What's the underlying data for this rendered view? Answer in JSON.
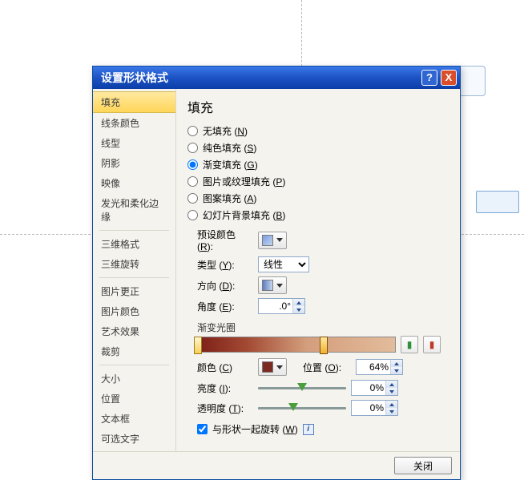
{
  "dialog": {
    "title": "设置形状格式",
    "close_button_label": "关闭"
  },
  "sidebar": {
    "items": [
      "填充",
      "线条颜色",
      "线型",
      "阴影",
      "映像",
      "发光和柔化边缘",
      "三维格式",
      "三维旋转",
      "图片更正",
      "图片颜色",
      "艺术效果",
      "裁剪",
      "大小",
      "位置",
      "文本框",
      "可选文字"
    ],
    "selected_index": 0,
    "separators_after": [
      5,
      7,
      11
    ]
  },
  "panel": {
    "heading": "填充",
    "fill_options": [
      {
        "label": "无填充",
        "key": "N"
      },
      {
        "label": "纯色填充",
        "key": "S"
      },
      {
        "label": "渐变填充",
        "key": "G"
      },
      {
        "label": "图片或纹理填充",
        "key": "P"
      },
      {
        "label": "图案填充",
        "key": "A"
      },
      {
        "label": "幻灯片背景填充",
        "key": "B"
      }
    ],
    "fill_selected_index": 2,
    "preset_label": "预设颜色",
    "preset_key": "R",
    "type_label": "类型",
    "type_key": "Y",
    "type_value": "线性",
    "direction_label": "方向",
    "direction_key": "D",
    "angle_label": "角度",
    "angle_key": "E",
    "angle_value": ".0°",
    "stops_title": "渐变光圈",
    "stops": [
      {
        "pos": 0
      },
      {
        "pos": 64
      }
    ],
    "color_label": "颜色",
    "color_key": "C",
    "position_label": "位置",
    "position_key": "O",
    "position_value": "64%",
    "brightness_label": "亮度",
    "brightness_key": "I",
    "brightness_value": "0%",
    "brightness_slider": 50,
    "transparency_label": "透明度",
    "transparency_key": "T",
    "transparency_value": "0%",
    "transparency_slider": 40,
    "rotate_label": "与形状一起旋转",
    "rotate_key": "W",
    "rotate_checked": true
  }
}
